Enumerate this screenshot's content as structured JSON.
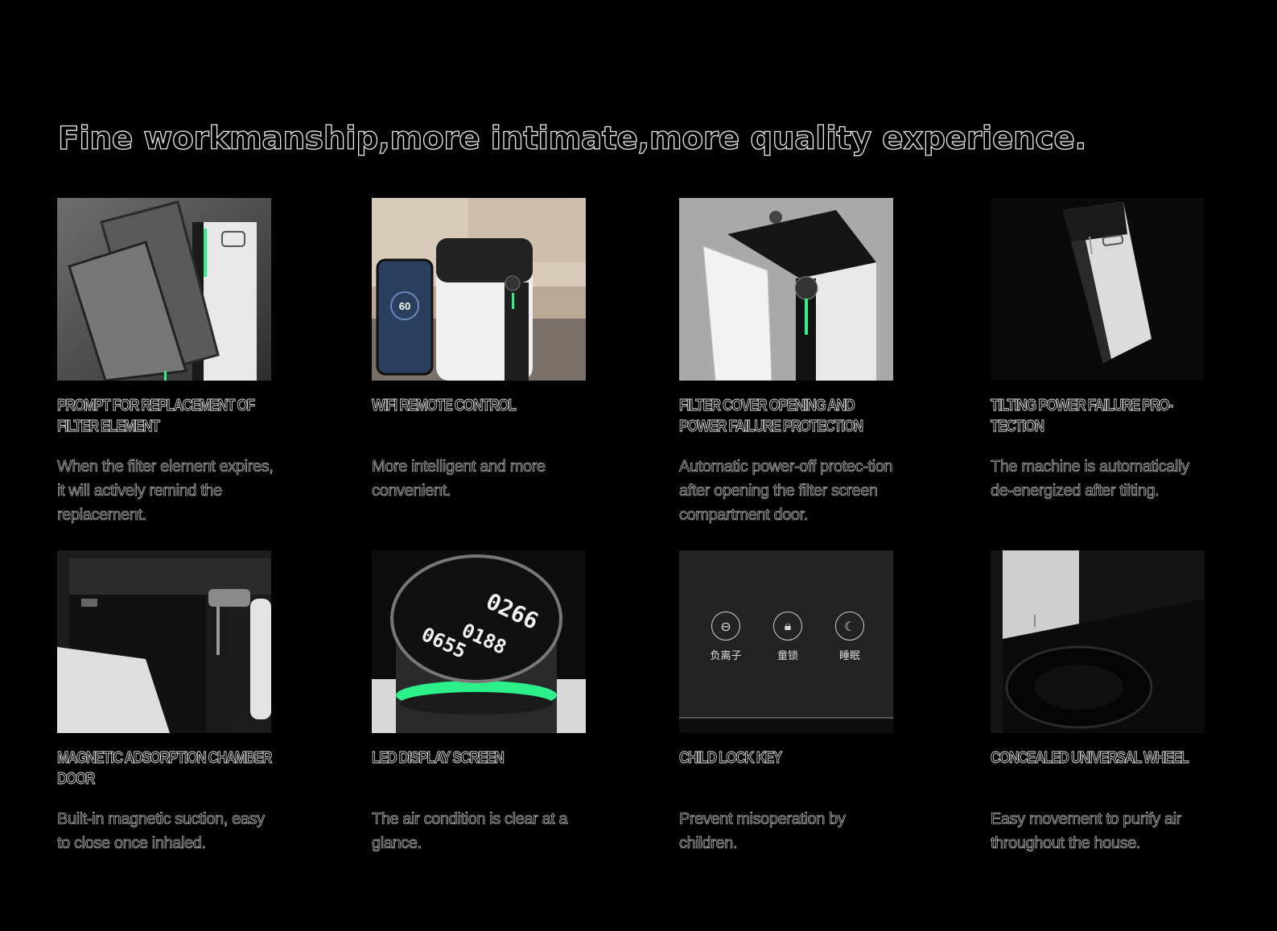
{
  "headline": "Fine workmanship,more intimate,more quality experience.",
  "features": [
    {
      "title": "PROMPT FOR REPLACEMENT OF FILTER ELEMENT",
      "desc": "When the filter element expires, it will actively remind the replacement.",
      "image": "filter-replacement-photo"
    },
    {
      "title": "WIFI REMOTE CONTROL",
      "desc": "More intelligent and more convenient.",
      "image": "wifi-app-photo"
    },
    {
      "title": "FILTER COVER OPENING AND POWER FAILURE PROTECTION",
      "desc": "Automatic power-off protec-tion after opening the filter screen compartment door.",
      "image": "filter-cover-photo"
    },
    {
      "title": "TILTING POWER FAILURE PRO-TECTION",
      "desc": "The machine is automatically de-energized after tilting.",
      "image": "tilting-photo"
    },
    {
      "title": "MAGNETIC ADSORPTION CHAMBER DOOR",
      "desc": "Built-in magnetic suction, easy to close once inhaled.",
      "image": "magnetic-door-photo"
    },
    {
      "title": "LED DISPLAY SCREEN",
      "desc": "The air condition is clear at a glance.",
      "image": "led-display-photo"
    },
    {
      "title": "CHILD LOCK KEY",
      "desc": "Prevent misoperation by children.",
      "image": "child-lock-photo"
    },
    {
      "title": "CONCEALED UNIVERSAL WHEEL",
      "desc": "Easy movement to purify air throughout the house.",
      "image": "wheel-photo"
    }
  ],
  "phone_screen": {
    "value": "60"
  },
  "led_screen": {
    "value1": "0266",
    "value2": "0188",
    "value3": "0655"
  },
  "panel_icons": [
    {
      "label": "负离子",
      "icon": "anion-icon"
    },
    {
      "label": "童锁",
      "icon": "lock-icon"
    },
    {
      "label": "睡眠",
      "icon": "moon-icon"
    }
  ],
  "colors": {
    "background": "#000000",
    "accent_green": "#2cf08a",
    "text_outline": "#e6e6e6"
  }
}
